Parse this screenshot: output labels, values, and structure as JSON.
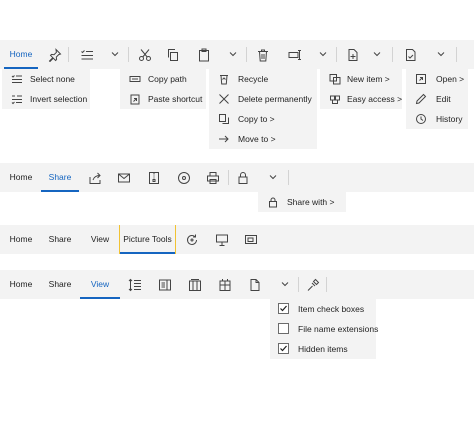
{
  "ribbon_home": {
    "tab_home": "Home",
    "menu_select": {
      "select_none": "Select none",
      "invert_selection": "Invert selection"
    },
    "menu_clipboard": {
      "copy_path": "Copy path",
      "paste_shortcut": "Paste shortcut"
    },
    "menu_organize": {
      "recycle": "Recycle",
      "delete_permanently": "Delete permanently",
      "copy_to": "Copy to >",
      "move_to": "Move to >"
    },
    "menu_new": {
      "new_item": "New item >",
      "easy_access": "Easy access >"
    },
    "menu_open": {
      "open": "Open >",
      "edit": "Edit",
      "history": "History"
    }
  },
  "ribbon_share": {
    "tab_home": "Home",
    "tab_share": "Share",
    "menu": {
      "share_with": "Share with >"
    }
  },
  "ribbon_picture": {
    "tab_home": "Home",
    "tab_share": "Share",
    "tab_view": "View",
    "tab_picture_tools": "Picture Tools"
  },
  "ribbon_view": {
    "tab_home": "Home",
    "tab_share": "Share",
    "tab_view": "View",
    "menu": {
      "item_check_boxes": {
        "label": "Item check boxes",
        "checked": true
      },
      "file_name_extensions": {
        "label": "File name extensions",
        "checked": false
      },
      "hidden_items": {
        "label": "Hidden items",
        "checked": true
      }
    }
  },
  "colors": {
    "accent": "#1565c0",
    "ribbon_bg": "#f3f3f3",
    "context_tab_border": "#f1c232",
    "text": "#1f1f1f"
  }
}
